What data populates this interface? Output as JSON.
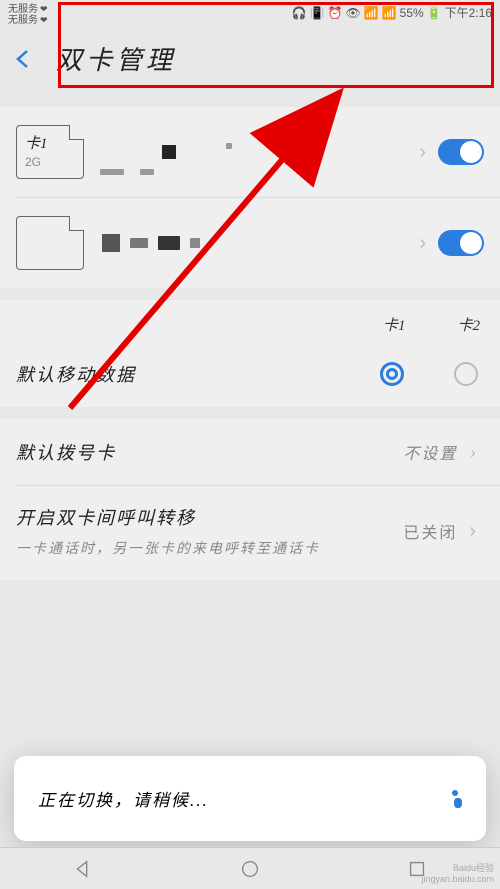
{
  "statusBar": {
    "noServiceLine1": "无服务",
    "noServiceLine2": "无服务",
    "battery": "55%",
    "time": "下午2:16"
  },
  "header": {
    "title": "双卡管理"
  },
  "sim1": {
    "name": "卡1",
    "network": "2G"
  },
  "sim2": {
    "name": "",
    "network": ""
  },
  "columns": {
    "card1": "卡1",
    "card2": "卡2"
  },
  "defaultData": {
    "label": "默认移动数据"
  },
  "defaultDial": {
    "label": "默认拨号卡",
    "value": "不设置"
  },
  "callForward": {
    "title": "开启双卡间呼叫转移",
    "desc": "一卡通话时，另一张卡的来电呼转至通话卡",
    "value": "已关闭"
  },
  "toast": {
    "message": "正在切换，请稍候..."
  },
  "watermark": {
    "brand": "Baidu经验",
    "url": "jingyan.baidu.com"
  }
}
